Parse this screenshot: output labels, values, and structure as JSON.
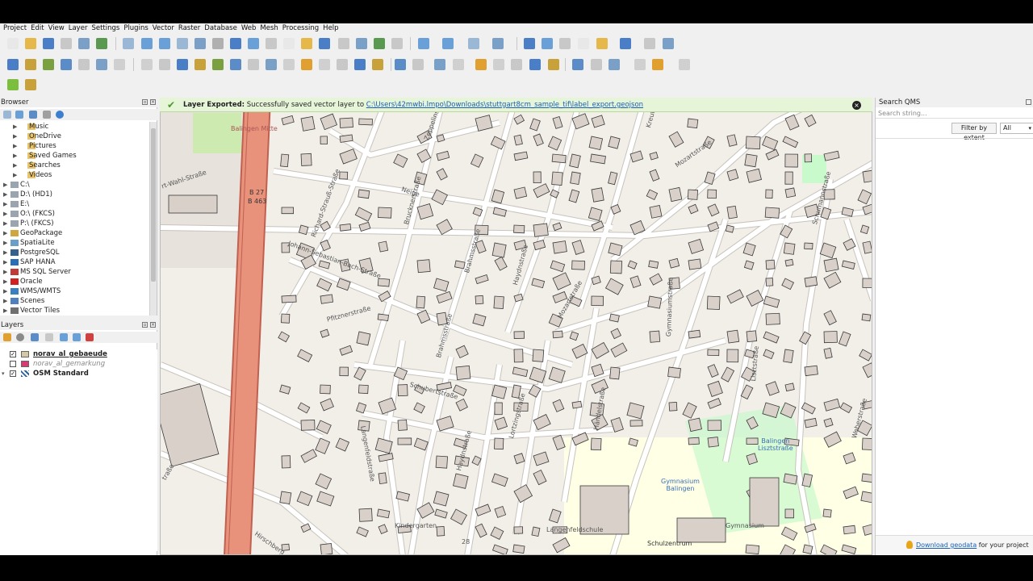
{
  "menu": [
    "Project",
    "Edit",
    "View",
    "Layer",
    "Settings",
    "Plugins",
    "Vector",
    "Raster",
    "Database",
    "Web",
    "Mesh",
    "Processing",
    "Help"
  ],
  "browser": {
    "title": "Browser",
    "items": [
      {
        "label": "Music",
        "icon": "folder-icon"
      },
      {
        "label": "OneDrive",
        "icon": "folder-icon"
      },
      {
        "label": "Pictures",
        "icon": "folder-icon"
      },
      {
        "label": "Saved Games",
        "icon": "folder-icon"
      },
      {
        "label": "Searches",
        "icon": "folder-icon"
      },
      {
        "label": "Videos",
        "icon": "folder-icon"
      },
      {
        "label": "C:\\",
        "icon": "drive-icon"
      },
      {
        "label": "D:\\ (HD1)",
        "icon": "drive-icon"
      },
      {
        "label": "E:\\",
        "icon": "drive-icon"
      },
      {
        "label": "O:\\ (FKCS)",
        "icon": "drive-icon"
      },
      {
        "label": "P:\\ (FKCS)",
        "icon": "drive-icon"
      },
      {
        "label": "GeoPackage",
        "icon": "geopackage-icon"
      },
      {
        "label": "SpatiaLite",
        "icon": "spatialite-icon"
      },
      {
        "label": "PostgreSQL",
        "icon": "postgresql-icon"
      },
      {
        "label": "SAP HANA",
        "icon": "sap-hana-icon"
      },
      {
        "label": "MS SQL Server",
        "icon": "mssql-icon"
      },
      {
        "label": "Oracle",
        "icon": "oracle-icon"
      },
      {
        "label": "WMS/WMTS",
        "icon": "wms-icon"
      },
      {
        "label": "Scenes",
        "icon": "scenes-icon"
      },
      {
        "label": "Vector Tiles",
        "icon": "vector-tiles-icon"
      }
    ]
  },
  "layers": {
    "title": "Layers",
    "items": [
      {
        "label": "norav_al_gebaeude",
        "checked": true,
        "swatch": "#d4c8a6"
      },
      {
        "label": "norav_al_gemarkung",
        "checked": false,
        "swatch": "#d93a73"
      },
      {
        "label": "OSM Standard",
        "checked": true,
        "swatch": "osm"
      }
    ]
  },
  "message": {
    "title": "Layer Exported:",
    "text": "Successfully saved vector layer to",
    "link": "C:\\Users\\42mwbi.lmpo\\Downloads\\stuttgart8cm_sample_tif\\label_export.geojson"
  },
  "search_qms": {
    "title": "Search QMS",
    "placeholder": "Search string...",
    "filter_button": "Filter by extent",
    "filter_value": "All",
    "footer_link": "Download geodata",
    "footer_text": "for your project"
  },
  "map_labels": {
    "balingen_mitte": "Balingen Mitte",
    "b27": "B 27",
    "b463": "B 463",
    "wahl": "rt-Wahl-Straße",
    "neige": "Neige",
    "strauss": "Richard-Strauß-Straße",
    "bach": "Johann-Sebastian-Bach-Straße",
    "bruckner": "Brucknerstraße",
    "zeppelin": "Zeppelinstraße",
    "gosler": "Goslerstraße",
    "kreutzer": "Kreutzerstraße",
    "mozart": "Mozartstraße",
    "mozart2": "Mozartstraße",
    "schumann": "Schumannstraße",
    "brahms": "Brahmsstraße",
    "brahms2": "Brahmsstraße",
    "haydn": "Haydnstraße",
    "haydn2": "Haydnstraße",
    "pfitzner": "Pfitznerstraße",
    "schubert": "Schubertstraße",
    "gymnasium": "Gymnasiumstraße",
    "liszt": "Lisztstraße",
    "haendel": "Händelstraße",
    "lortzing": "Lortzingstraße",
    "langenfeld": "Langenfeldstraße",
    "weber": "Weberstraße",
    "balingen_liszt": "Balingen\nLisztstraße",
    "gym_balingen": "Gymnasium\nBalingen",
    "gymnasium_area": "Gymnasium",
    "schulzentrum": "Schulzentrum",
    "hirsch": "Hirschberg",
    "strasse": "traße",
    "kindergarten": "Kindergarten",
    "langenfeldschule": "Langenfeldschule",
    "n28": "28"
  },
  "colors": {
    "road_major": "#e8927c",
    "building": "#d9d0c9",
    "background": "#f2efe9",
    "park": "#c8facc",
    "school": "#ffffe5"
  }
}
